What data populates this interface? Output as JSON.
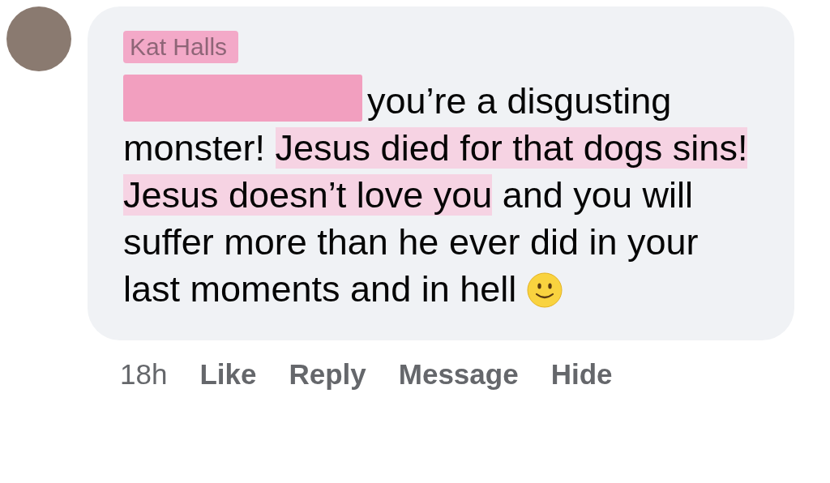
{
  "comment": {
    "author": "Kat Halls",
    "author_redacted": true,
    "body": [
      {
        "kind": "redaction"
      },
      {
        "kind": "text",
        "text": "you’re a disgusting monster! ",
        "highlighted": false
      },
      {
        "kind": "text",
        "text": "Jesus died for that dogs sins! ",
        "highlighted": true
      },
      {
        "kind": "text",
        "text": "Jesus doesn’t love you",
        "highlighted": true
      },
      {
        "kind": "text",
        "text": " and you will suffer more than he ever did in your last moments and in hell ",
        "highlighted": false
      },
      {
        "kind": "emoji"
      }
    ],
    "time": "18h",
    "actions": [
      "Like",
      "Reply",
      "Message",
      "Hide"
    ]
  }
}
